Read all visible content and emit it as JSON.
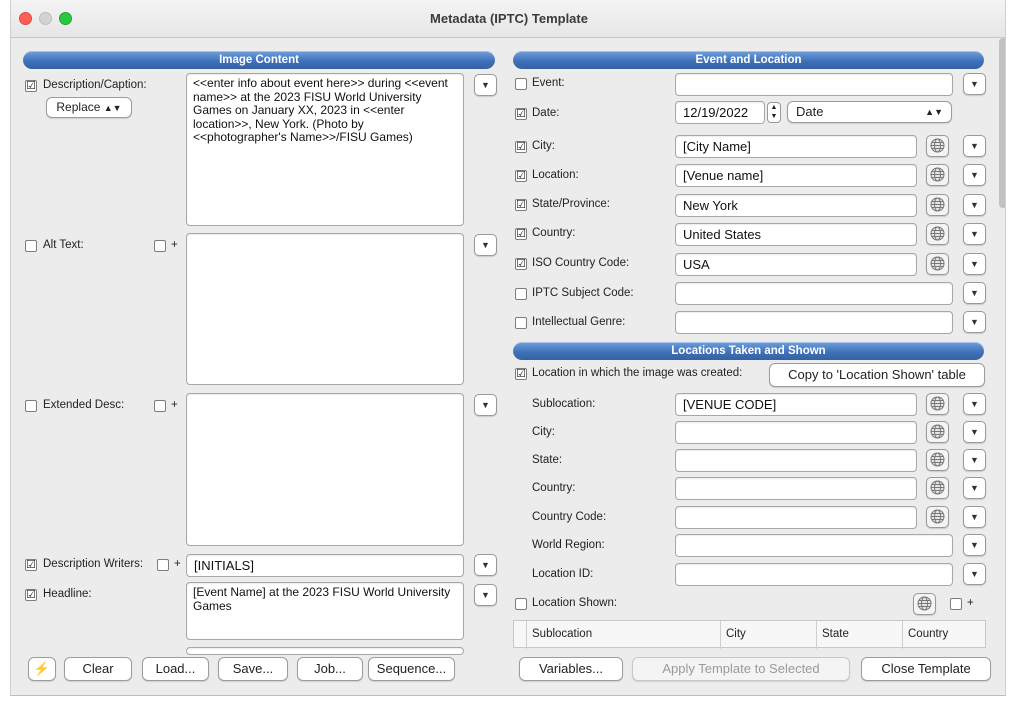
{
  "window": {
    "title": "Metadata (IPTC) Template"
  },
  "colors": {
    "close": "#ff5f57",
    "minimize": "#d3d3d3",
    "zoom": "#28c840",
    "header": "#3d6fb8"
  },
  "left": {
    "header": "Image Content",
    "description": {
      "label": "Description/Caption:",
      "checked": "☑",
      "mode": "Replace",
      "value": "<<enter info about event here>> during <<event name>> at the 2023 FISU World University Games on January XX, 2023 in <<enter location>>, New York. (Photo by <<photographer's Name>>/FISU Games)"
    },
    "alt_text": {
      "label": "Alt Text:",
      "plus": "+",
      "value": ""
    },
    "extended": {
      "label": "Extended Desc:",
      "plus": "+",
      "value": ""
    },
    "writers": {
      "label": "Description Writers:",
      "plus": "+",
      "checked": "☑",
      "value": "[INITIALS]"
    },
    "headline": {
      "label": "Headline:",
      "checked": "☑",
      "value": "[Event Name] at the 2023 FISU World University Games"
    }
  },
  "right": {
    "header": "Event and Location",
    "fields": [
      {
        "label": "Event:",
        "checked": "",
        "value": ""
      },
      {
        "label": "Date:",
        "checked": "☑",
        "value": "12/19/2022",
        "select": "Date"
      },
      {
        "label": "City:",
        "checked": "☑",
        "value": "[City Name]"
      },
      {
        "label": "Location:",
        "checked": "☑",
        "value": "[Venue name]"
      },
      {
        "label": "State/Province:",
        "checked": "☑",
        "value": "New York"
      },
      {
        "label": "Country:",
        "checked": "☑",
        "value": "United States"
      },
      {
        "label": "ISO Country Code:",
        "checked": "☑",
        "value": "USA"
      },
      {
        "label": "IPTC Subject Code:",
        "checked": "",
        "value": ""
      },
      {
        "label": "Intellectual Genre:",
        "checked": "",
        "value": ""
      }
    ],
    "locations_header": "Locations Taken and Shown",
    "created_label": "Location in which the image was created:",
    "created_checked": "☑",
    "copy_button": "Copy to 'Location Shown' table",
    "created_fields": [
      {
        "label": "Sublocation:",
        "value": "[VENUE CODE]"
      },
      {
        "label": "City:",
        "value": ""
      },
      {
        "label": "State:",
        "value": ""
      },
      {
        "label": "Country:",
        "value": ""
      },
      {
        "label": "Country Code:",
        "value": ""
      },
      {
        "label": "World Region:",
        "value": ""
      },
      {
        "label": "Location ID:",
        "value": ""
      }
    ],
    "shown_label": "Location Shown:",
    "shown_plus": "+",
    "table_columns": [
      "Sublocation",
      "City",
      "State",
      "Country"
    ]
  },
  "bottom": {
    "flash_glyph": "⚡",
    "clear": "Clear",
    "load": "Load...",
    "save": "Save...",
    "job": "Job...",
    "sequence": "Sequence...",
    "variables": "Variables...",
    "apply": "Apply Template to Selected",
    "close": "Close Template"
  }
}
